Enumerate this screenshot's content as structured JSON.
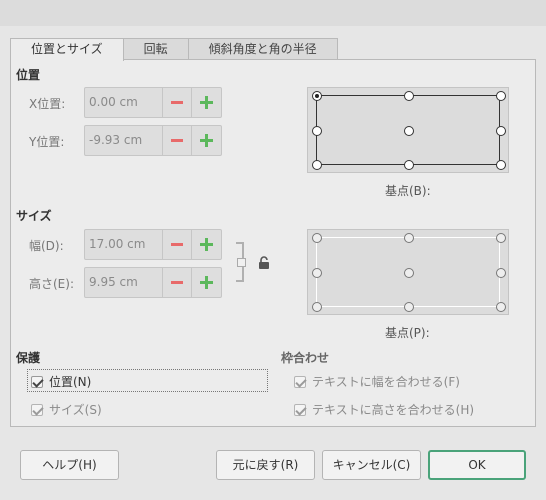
{
  "tabs": [
    "位置とサイズ",
    "回転",
    "傾斜角度と角の半径"
  ],
  "position": {
    "heading": "位置",
    "x_label": "X位置:",
    "x_value": "0.00 cm",
    "y_label": "Y位置:",
    "y_value": "-9.93 cm",
    "base_label": "基点(B):"
  },
  "size": {
    "heading": "サイズ",
    "width_label": "幅(D):",
    "width_value": "17.00 cm",
    "height_label": "高さ(E):",
    "height_value": "9.95 cm",
    "base_label": "基点(P):"
  },
  "protect": {
    "heading": "保護",
    "position": "位置(N)",
    "size": "サイズ(S)"
  },
  "adapt": {
    "heading": "枠合わせ",
    "fit_width": "テキストに幅を合わせる(F)",
    "fit_height": "テキストに高さを合わせる(H)"
  },
  "buttons": {
    "help": "ヘルプ(H)",
    "reset": "元に戻す(R)",
    "cancel": "キャンセル(C)",
    "ok": "OK"
  }
}
